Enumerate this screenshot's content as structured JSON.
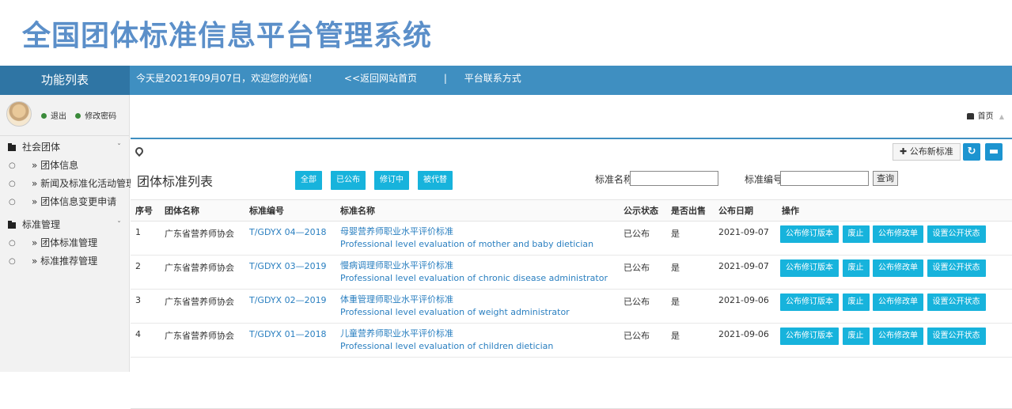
{
  "header": {
    "title": "全国团体标准信息平台管理系统"
  },
  "topbar": {
    "menu_title": "功能列表",
    "welcome": "今天是2021年09月07日，欢迎您的光临！",
    "back_link": "<<返回网站首页",
    "separator": "|",
    "contact_link": "平台联系方式"
  },
  "user": {
    "logout": "退出",
    "change_password": "修改密码"
  },
  "sidebar": {
    "groups": [
      {
        "label": "社会团体",
        "chevron": "ˇ",
        "items": [
          "» 团体信息",
          "» 新闻及标准化活动管理",
          "» 团体信息变更申请"
        ]
      },
      {
        "label": "标准管理",
        "chevron": "ˇ",
        "items": [
          "» 团体标准管理",
          "» 标准推荐管理"
        ]
      }
    ]
  },
  "breadcrumb": {
    "home": "首页",
    "arrow": "▲"
  },
  "toolbar": {
    "publish_label": "✚ 公布新标准",
    "refresh_icon": "↻",
    "collapse_icon": "▬"
  },
  "list": {
    "title": "团体标准列表",
    "filters": [
      "全部",
      "已公布",
      "修订中",
      "被代替"
    ],
    "name_label": "标准名称",
    "code_label": "标准编号",
    "query_label": "查询",
    "name_value": "",
    "code_value": ""
  },
  "table": {
    "headers": [
      "序号",
      "团体名称",
      "标准编号",
      "标准名称",
      "公示状态",
      "是否出售",
      "公布日期",
      "操作"
    ],
    "rows": [
      {
        "no": "1",
        "org": "广东省营养师协会",
        "code": "T/GDYX 04—2018",
        "name_cn": "母婴营养师职业水平评价标准",
        "name_en": "Professional level evaluation of mother and baby dietician",
        "status": "已公布",
        "sale": "是",
        "date": "2021-09-07"
      },
      {
        "no": "2",
        "org": "广东省营养师协会",
        "code": "T/GDYX 03—2019",
        "name_cn": "慢病调理师职业水平评价标准",
        "name_en": "Professional level evaluation of chronic disease administrator",
        "status": "已公布",
        "sale": "是",
        "date": "2021-09-07"
      },
      {
        "no": "3",
        "org": "广东省营养师协会",
        "code": "T/GDYX 02—2019",
        "name_cn": "体重管理师职业水平评价标准",
        "name_en": "Professional level evaluation of weight administrator",
        "status": "已公布",
        "sale": "是",
        "date": "2021-09-06"
      },
      {
        "no": "4",
        "org": "广东省营养师协会",
        "code": "T/GDYX 01—2018",
        "name_cn": "儿童营养师职业水平评价标准",
        "name_en": "Professional level evaluation of children dietician",
        "status": "已公布",
        "sale": "是",
        "date": "2021-09-06"
      }
    ],
    "ops": [
      "公布修订版本",
      "废止",
      "公布修改单",
      "设置公开状态"
    ]
  },
  "colors": {
    "accent": "#3f8fc1",
    "button": "#17b3dc",
    "title": "#5b8fc9"
  }
}
